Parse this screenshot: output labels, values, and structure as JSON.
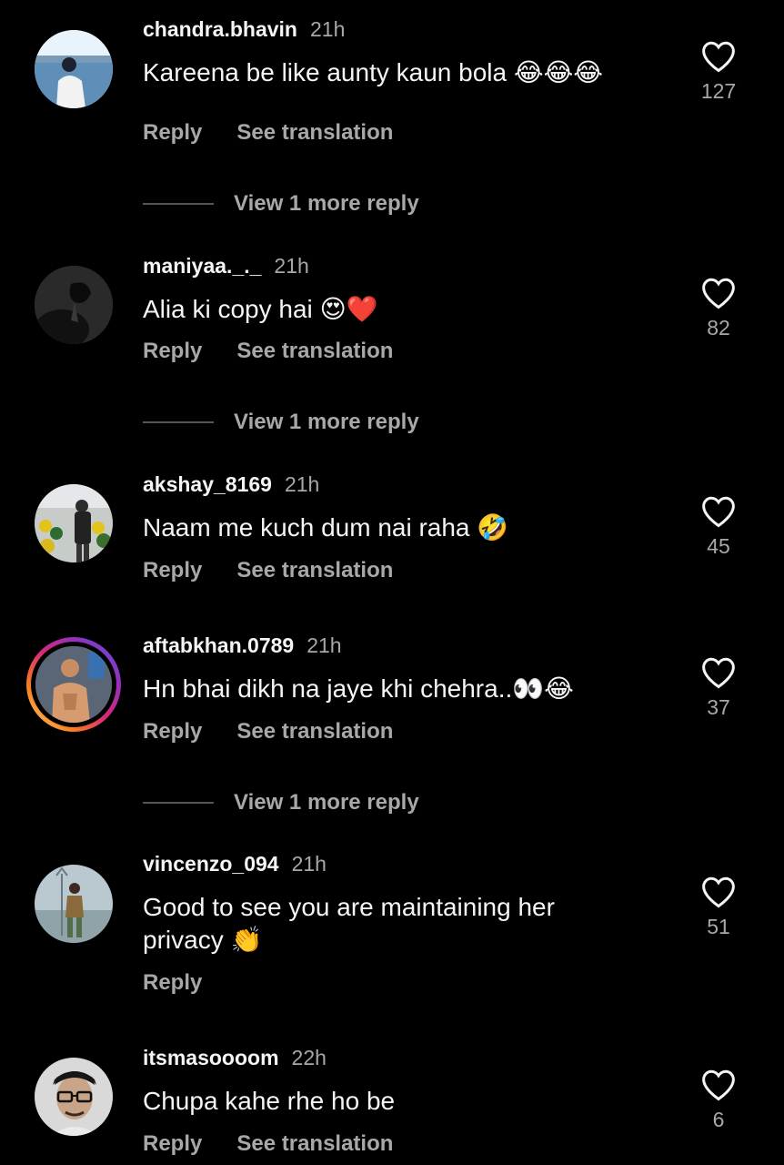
{
  "comments": [
    {
      "username": "chandra.bhavin",
      "time": "21h",
      "text": "Kareena be like aunty kaun bola 😂😂😂",
      "likes": "127",
      "reply_label": "Reply",
      "translate_label": "See translation",
      "view_more": "View 1 more reply",
      "avatar": "person-sea-photo"
    },
    {
      "username": "maniyaa._._",
      "time": "21h",
      "text": "Alia ki copy hai 😍❤️",
      "likes": "82",
      "reply_label": "Reply",
      "translate_label": "See translation",
      "view_more": "View 1 more reply",
      "avatar": "dark-silhouette-photo"
    },
    {
      "username": "akshay_8169",
      "time": "21h",
      "text": "Naam me kuch dum nai raha 🤣",
      "likes": "45",
      "reply_label": "Reply",
      "translate_label": "See translation",
      "avatar": "crowd-photo"
    },
    {
      "username": "aftabkhan.0789",
      "time": "21h",
      "text": "Hn bhai dikh na jaye khi chehra..👀😂",
      "likes": "37",
      "reply_label": "Reply",
      "translate_label": "See translation",
      "view_more": "View 1 more reply",
      "avatar": "mirror-selfie-photo"
    },
    {
      "username": "vincenzo_094",
      "time": "21h",
      "text": "Good to see you are maintaining her privacy 👏",
      "likes": "51",
      "reply_label": "Reply",
      "avatar": "trident-figure-photo"
    },
    {
      "username": "itsmasoooom",
      "time": "22h",
      "text": "Chupa kahe rhe ho be",
      "likes": "6",
      "reply_label": "Reply",
      "translate_label": "See translation",
      "avatar": "man-with-glasses-photo"
    }
  ],
  "colors": {
    "background": "#000000",
    "primary_text": "#f5f5f5",
    "secondary_text": "#a8a8a8",
    "story_ring": "#d62976"
  }
}
